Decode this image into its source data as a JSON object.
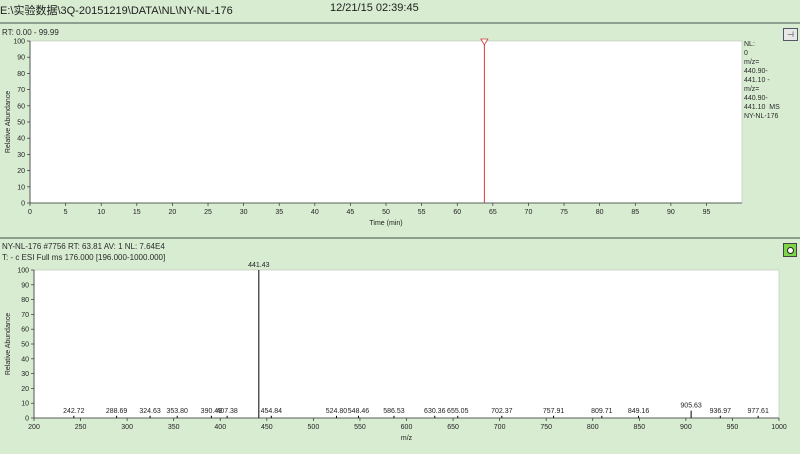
{
  "header": {
    "path": "E:\\实验数据\\3Q-20151219\\DATA\\NL\\NY-NL-176",
    "timestamp": "12/21/15 02:39:45"
  },
  "top_pane": {
    "range_label": "RT: 0.00 - 99.99",
    "legend_lines": [
      "NL:",
      "0",
      "m/z=",
      "440.90-",
      "441.10 -",
      "m/z=",
      "440.90-",
      "441.10  MS",
      "NY-NL-176"
    ]
  },
  "bottom_pane": {
    "scan_label": "NY-NL-176 #7756   RT: 63.81   AV: 1   NL: 7.64E4",
    "filter_label": "T: - c ESI Full ms 176.000 [196.000-1000.000]"
  },
  "chart_data": [
    {
      "type": "line",
      "title": "",
      "xlabel": "Time (min)",
      "ylabel": "Relative Abundance",
      "xlim": [
        0,
        99.99
      ],
      "ylim": [
        0,
        100
      ],
      "x_ticks": [
        0,
        5,
        10,
        15,
        20,
        25,
        30,
        35,
        40,
        45,
        50,
        55,
        60,
        65,
        70,
        75,
        80,
        85,
        90,
        95
      ],
      "y_ticks": [
        0,
        10,
        20,
        30,
        40,
        50,
        60,
        70,
        80,
        90,
        100
      ],
      "line_color": "#d23c3c",
      "peak": {
        "x": 63.81,
        "y": 100
      },
      "grid": false
    },
    {
      "type": "bar",
      "title": "",
      "xlabel": "m/z",
      "ylabel": "Relative Abundance",
      "xlim": [
        200,
        1000
      ],
      "ylim": [
        0,
        100
      ],
      "x_ticks": [
        200,
        250,
        300,
        350,
        400,
        450,
        500,
        550,
        600,
        650,
        700,
        750,
        800,
        850,
        900,
        950,
        1000
      ],
      "y_ticks": [
        0,
        10,
        20,
        30,
        40,
        50,
        60,
        70,
        80,
        90,
        100
      ],
      "peaks": [
        {
          "mz": 242.72,
          "intensity": 1.5,
          "label": "242.72"
        },
        {
          "mz": 288.69,
          "intensity": 1.5,
          "label": "288.69"
        },
        {
          "mz": 324.63,
          "intensity": 1.5,
          "label": "324.63"
        },
        {
          "mz": 353.8,
          "intensity": 1.5,
          "label": "353.80"
        },
        {
          "mz": 390.49,
          "intensity": 1.5,
          "label": "390.49"
        },
        {
          "mz": 407.38,
          "intensity": 1.5,
          "label": "407.38"
        },
        {
          "mz": 441.43,
          "intensity": 100,
          "label": "441.43"
        },
        {
          "mz": 454.84,
          "intensity": 1.5,
          "label": "454.84"
        },
        {
          "mz": 524.8,
          "intensity": 1.5,
          "label": "524.80"
        },
        {
          "mz": 548.46,
          "intensity": 1.5,
          "label": "548.46"
        },
        {
          "mz": 586.53,
          "intensity": 1.5,
          "label": "586.53"
        },
        {
          "mz": 630.36,
          "intensity": 1.5,
          "label": "630.36"
        },
        {
          "mz": 655.05,
          "intensity": 1.5,
          "label": "655.05"
        },
        {
          "mz": 702.37,
          "intensity": 1.5,
          "label": "702.37"
        },
        {
          "mz": 757.91,
          "intensity": 1.5,
          "label": "757.91"
        },
        {
          "mz": 809.71,
          "intensity": 1.5,
          "label": "809.71"
        },
        {
          "mz": 849.16,
          "intensity": 1.5,
          "label": "849.16"
        },
        {
          "mz": 905.63,
          "intensity": 5,
          "label": "905.63"
        },
        {
          "mz": 936.97,
          "intensity": 1.5,
          "label": "936.97"
        },
        {
          "mz": 977.61,
          "intensity": 1.5,
          "label": "977.61"
        }
      ],
      "bar_color": "#000000",
      "grid": false
    }
  ]
}
